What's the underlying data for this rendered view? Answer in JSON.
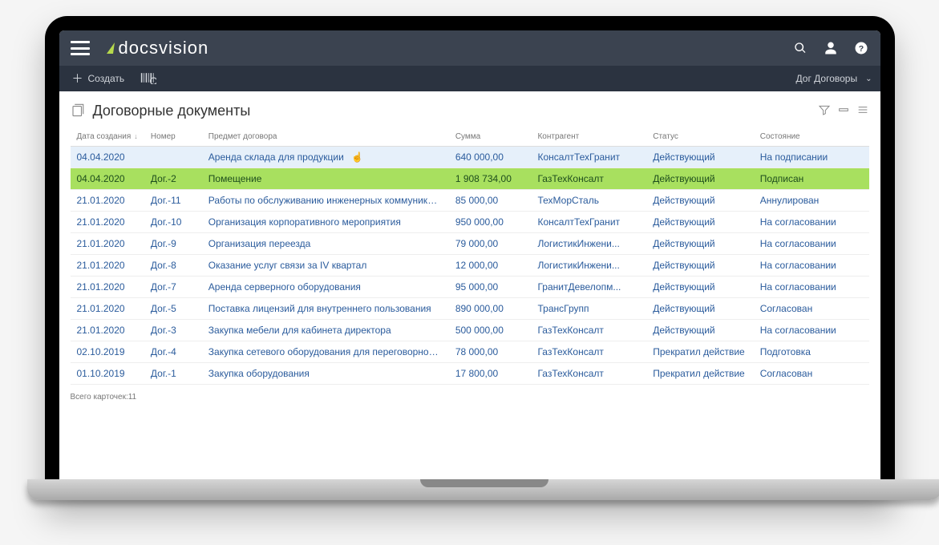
{
  "brand": "docsvision",
  "secbar": {
    "create_label": "Создать",
    "right_label": "Дог Договоры"
  },
  "page": {
    "title": "Договорные документы",
    "footer": "Всего карточек:11"
  },
  "columns": {
    "date": "Дата создания",
    "number": "Номер",
    "subject": "Предмет договора",
    "sum": "Сумма",
    "counterparty": "Контрагент",
    "status": "Статус",
    "state": "Состояние"
  },
  "rows": [
    {
      "date": "04.04.2020",
      "number": "",
      "subject": "Аренда склада для продукции",
      "sum": "640 000,00",
      "party": "КонсалтТехГранит",
      "status": "Действующий",
      "state": "На подписании",
      "hover": true,
      "cursor": true
    },
    {
      "date": "04.04.2020",
      "number": "Дог.-2",
      "subject": "Помещение",
      "sum": "1 908 734,00",
      "party": "ГазТехКонсалт",
      "status": "Действующий",
      "state": "Подписан",
      "highlight": true
    },
    {
      "date": "21.01.2020",
      "number": "Дог.-11",
      "subject": "Работы по обслуживанию инженерных коммуникаций",
      "sum": "85 000,00",
      "party": "ТехМорСталь",
      "status": "Действующий",
      "state": "Аннулирован"
    },
    {
      "date": "21.01.2020",
      "number": "Дог.-10",
      "subject": "Организация корпоративного мероприятия",
      "sum": "950 000,00",
      "party": "КонсалтТехГранит",
      "status": "Действующий",
      "state": "На согласовании"
    },
    {
      "date": "21.01.2020",
      "number": "Дог.-9",
      "subject": "Организация переезда",
      "sum": "79 000,00",
      "party": "ЛогистикИнжени...",
      "status": "Действующий",
      "state": "На согласовании"
    },
    {
      "date": "21.01.2020",
      "number": "Дог.-8",
      "subject": "Оказание услуг связи за IV квартал",
      "sum": "12 000,00",
      "party": "ЛогистикИнжени...",
      "status": "Действующий",
      "state": "На согласовании"
    },
    {
      "date": "21.01.2020",
      "number": "Дог.-7",
      "subject": "Аренда серверного оборудования",
      "sum": "95 000,00",
      "party": "ГранитДевелопм...",
      "status": "Действующий",
      "state": "На согласовании"
    },
    {
      "date": "21.01.2020",
      "number": "Дог.-5",
      "subject": "Поставка лицензий для внутреннего пользования",
      "sum": "890 000,00",
      "party": "ТрансГрупп",
      "status": "Действующий",
      "state": "Согласован"
    },
    {
      "date": "21.01.2020",
      "number": "Дог.-3",
      "subject": "Закупка мебели для кабинета директора",
      "sum": "500 000,00",
      "party": "ГазТехКонсалт",
      "status": "Действующий",
      "state": "На согласовании"
    },
    {
      "date": "02.10.2019",
      "number": "Дог.-4",
      "subject": "Закупка сетевого оборудования для переговорной ко...",
      "sum": "78 000,00",
      "party": "ГазТехКонсалт",
      "status": "Прекратил действие",
      "state": "Подготовка"
    },
    {
      "date": "01.10.2019",
      "number": "Дог.-1",
      "subject": "Закупка оборудования",
      "sum": "17 800,00",
      "party": "ГазТехКонсалт",
      "status": "Прекратил действие",
      "state": "Согласован"
    }
  ]
}
